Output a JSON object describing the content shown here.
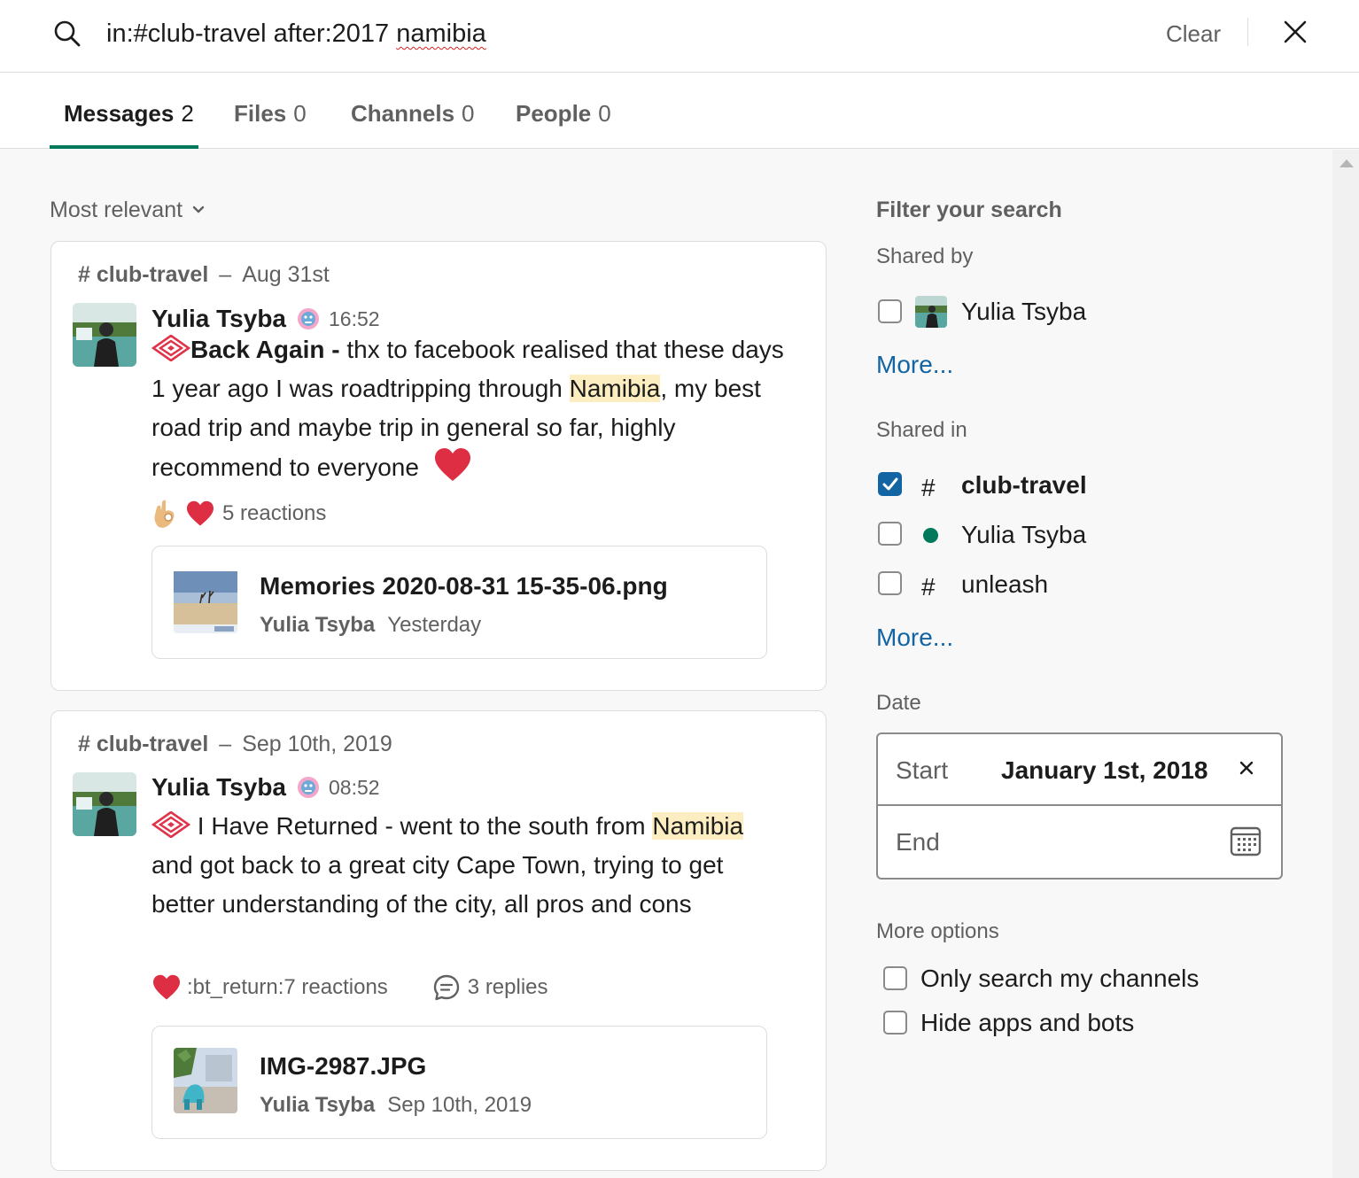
{
  "search": {
    "query_prefix": "in:#club-travel after:2017 ",
    "query_misspelled": "namibia",
    "clear_label": "Clear"
  },
  "tabs": [
    {
      "label": "Messages",
      "count": "2",
      "active": true
    },
    {
      "label": "Files",
      "count": "0"
    },
    {
      "label": "Channels",
      "count": "0"
    },
    {
      "label": "People",
      "count": "0"
    }
  ],
  "sort": {
    "label": "Most relevant"
  },
  "results": [
    {
      "channel": "# club-travel",
      "separator": "–",
      "date": "Aug 31st",
      "sender": "Yulia Tsyba",
      "time": "16:52",
      "text_title": "Back Again -",
      "text_1": " thx to facebook realised that these days 1 year ago I was roadtripping through ",
      "highlight": "Namibia",
      "text_2": ", my best road trip and maybe trip in general so far, highly recommend to everyone ",
      "reactions_label": "5 reactions",
      "file": {
        "name": "Memories 2020-08-31 15-35-06.png",
        "owner": "Yulia Tsyba",
        "when": "Yesterday"
      }
    },
    {
      "channel": "# club-travel",
      "separator": "–",
      "date": "Sep 10th, 2019",
      "sender": "Yulia Tsyba",
      "time": "08:52",
      "text_1": " I Have Returned - went to the south from ",
      "highlight": "Namibia",
      "text_2": " and got back to a great city Cape Town, trying to get better understanding of the city, all pros and cons",
      "reactions_label": ":bt_return:7 reactions",
      "replies_label": "3 replies",
      "file": {
        "name": "IMG-2987.JPG",
        "owner": "Yulia Tsyba",
        "when": "Sep 10th, 2019"
      }
    }
  ],
  "filters": {
    "title": "Filter your search",
    "shared_by_label": "Shared by",
    "shared_by_items": [
      {
        "label": "Yulia Tsyba",
        "checked": false
      }
    ],
    "more_label": "More...",
    "shared_in_label": "Shared in",
    "shared_in_items": [
      {
        "prefix": "#",
        "label": "club-travel",
        "checked": true
      },
      {
        "prefix": "dot",
        "label": "Yulia Tsyba",
        "checked": false
      },
      {
        "prefix": "#",
        "label": "unleash",
        "checked": false
      }
    ],
    "date_label": "Date",
    "date_start_label": "Start",
    "date_start_value": "January 1st, 2018",
    "date_end_label": "End",
    "more_options_label": "More options",
    "options": [
      {
        "label": "Only search my channels",
        "checked": false
      },
      {
        "label": "Hide apps and bots",
        "checked": false
      }
    ]
  },
  "colors": {
    "accent_green": "#007a5a",
    "link_blue": "#1264a3",
    "highlight": "#fdeec1",
    "heart_red": "#dd2e44"
  },
  "icons": [
    "search-icon",
    "close-icon",
    "chevron-down-icon",
    "ok-hand-emoji-icon",
    "heart-emoji-icon",
    "thread-replies-icon",
    "calendar-icon",
    "clear-date-icon",
    "diamond-logo-icon"
  ]
}
